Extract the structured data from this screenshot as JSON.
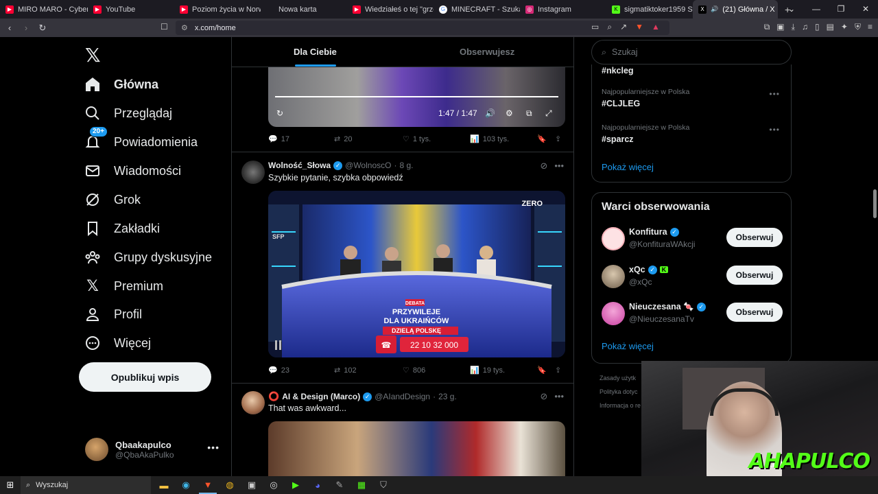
{
  "browser": {
    "tabs": [
      {
        "label": "MIRO MARO - Cyber Mari",
        "icon": "youtube-icon",
        "color": "#ff0033"
      },
      {
        "label": "YouTube",
        "icon": "youtube-icon",
        "color": "#ff0033"
      },
      {
        "label": "Poziom życia w Norwegii",
        "icon": "youtube-icon",
        "color": "#ff0033"
      },
      {
        "label": "Nowa karta",
        "icon": "",
        "color": ""
      },
      {
        "label": "Wiedziałeś o tej \"grze\" mi",
        "icon": "youtube-icon",
        "color": "#ff0033"
      },
      {
        "label": "MINECRAFT - Szukaj w Go",
        "icon": "google-icon",
        "color": "#ffffff"
      },
      {
        "label": "Instagram",
        "icon": "instagram-icon",
        "color": "#d62976"
      },
      {
        "label": "sigmatiktoker1959 Stre",
        "icon": "kick-icon",
        "color": "#53fc18"
      },
      {
        "label": "(21) Główna / X",
        "icon": "x-icon",
        "color": "#000000"
      }
    ],
    "url": "x.com/home"
  },
  "sidebar": {
    "logo": "𝕏",
    "items": [
      {
        "label": "Główna",
        "icon": "home-icon"
      },
      {
        "label": "Przeglądaj",
        "icon": "search-icon"
      },
      {
        "label": "Powiadomienia",
        "icon": "bell-icon",
        "badge": "20+"
      },
      {
        "label": "Wiadomości",
        "icon": "mail-icon"
      },
      {
        "label": "Grok",
        "icon": "grok-icon"
      },
      {
        "label": "Zakładki",
        "icon": "bookmark-icon"
      },
      {
        "label": "Grupy dyskusyjne",
        "icon": "people-icon"
      },
      {
        "label": "Premium",
        "icon": "x-icon"
      },
      {
        "label": "Profil",
        "icon": "person-icon"
      },
      {
        "label": "Więcej",
        "icon": "more-circle-icon"
      }
    ],
    "post_button": "Opublikuj wpis",
    "profile": {
      "name": "Qbaakapulco",
      "handle": "@QbaAkaPulko"
    }
  },
  "feed": {
    "tabs": {
      "for_you": "Dla Ciebie",
      "following": "Obserwujesz"
    },
    "tweet1": {
      "video_time": "1:47 / 1:47",
      "progress": 1.0,
      "stats": {
        "replies": "17",
        "reposts": "20",
        "likes": "1 tys.",
        "views": "103 tys."
      }
    },
    "tweet2": {
      "name": "Wolność_Słowa",
      "handle": "@WolnoscO",
      "time": "8 g.",
      "text": "Szybkie pytanie, szybka obpowiedź",
      "video_overlay": {
        "logo": "ZERO",
        "tag": "DEBATA",
        "title1": "PRZYWILEJE",
        "title2": "DLA UKRAIŃCÓW",
        "title3": "DZIELĄ POLSKĘ",
        "phone": "22 10 32 000",
        "left_logo": "SFP"
      },
      "stats": {
        "replies": "23",
        "reposts": "102",
        "likes": "806",
        "views": "19 tys."
      }
    },
    "tweet3": {
      "name": "AI & Design (Marco)",
      "handle": "@AIandDesign",
      "time": "23 g.",
      "text": "That was awkward..."
    }
  },
  "right": {
    "search_placeholder": "Szukaj",
    "trends": [
      {
        "category": "",
        "tag": "#nkcleg"
      },
      {
        "category": "Najpopularniejsze w Polska",
        "tag": "#CLJLEG"
      },
      {
        "category": "Najpopularniejsze w Polska",
        "tag": "#sparcz"
      }
    ],
    "show_more": "Pokaż więcej",
    "who_to_follow": {
      "title": "Warci obserwowania",
      "users": [
        {
          "name": "Konfitura",
          "handle": "@KonfituraWAkcji",
          "button": "Obserwuj"
        },
        {
          "name": "xQc",
          "handle": "@xQc",
          "button": "Obserwuj"
        },
        {
          "name": "Nieuczesana 🍬",
          "handle": "@NieuczesanaTv",
          "button": "Obserwuj"
        }
      ],
      "show_more": "Pokaż więcej"
    },
    "footer": [
      "Zasady użytk",
      "Polityka dotyc",
      "Informacja o re"
    ]
  },
  "overlay": {
    "kick": "KICK",
    "brand": "AHAPULCO"
  },
  "taskbar": {
    "search": "Wyszukaj"
  }
}
